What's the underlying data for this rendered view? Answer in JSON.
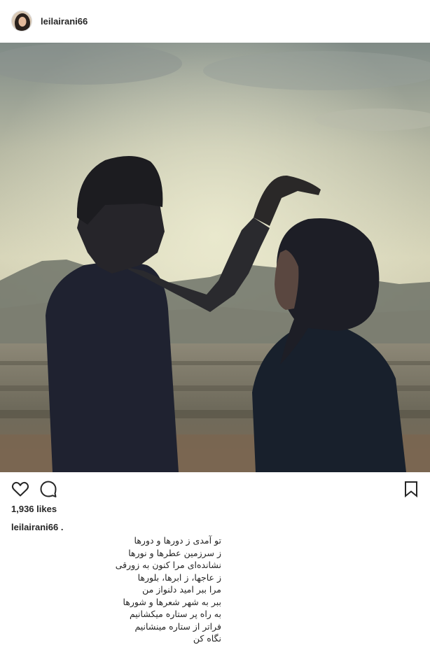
{
  "post": {
    "username": "leilairani66",
    "likes_text": "1,936 likes",
    "caption_user": "leilairani66 .",
    "caption_lines": [
      "تو آمدی ز دورها و دورها",
      "ز سرزمین عطرها و نورها",
      "نشانده‌ای مرا کنون به زورقی",
      "ز عاجها، ز ابرها، بلورها",
      "مرا ببر امید دلنواز من",
      "ببر به شهر شعرها و شورها",
      "به راه پر ستاره میکشانیم",
      "فراتر از ستاره مینشانیم",
      "نگاه کن"
    ]
  },
  "icons": {
    "like": "heart-icon",
    "comment": "comment-icon",
    "save": "bookmark-icon"
  },
  "colors": {
    "text": "#262626",
    "border": "#dbdbdb"
  }
}
